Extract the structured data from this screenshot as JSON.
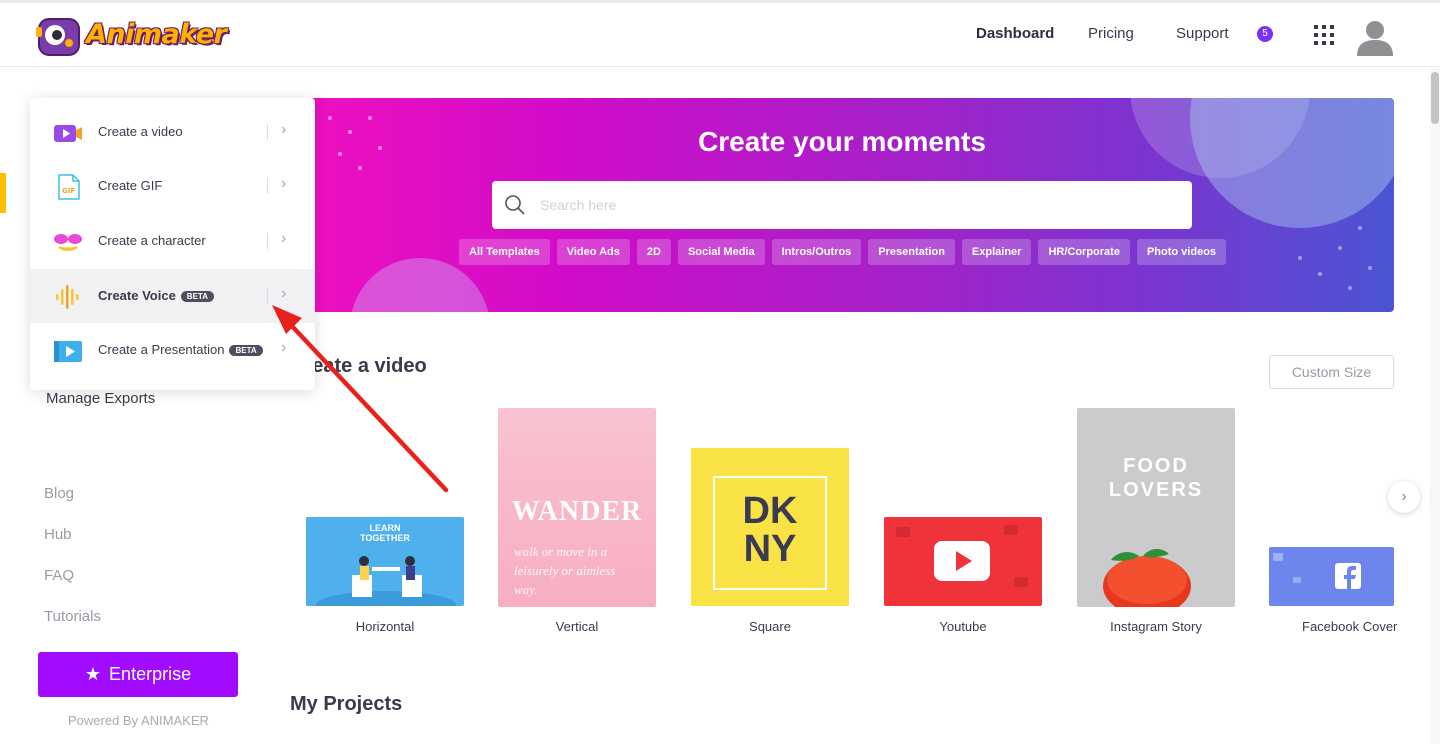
{
  "header": {
    "logo_text": "Animaker",
    "nav": [
      "Dashboard",
      "Pricing",
      "Support"
    ],
    "notification_count": "5"
  },
  "dropdown": {
    "items": [
      {
        "label": "Create a video",
        "beta": ""
      },
      {
        "label": "Create GIF",
        "beta": ""
      },
      {
        "label": "Create a character",
        "beta": ""
      },
      {
        "label": "Create Voice",
        "beta": "BETA"
      },
      {
        "label": "Create a Presentation",
        "beta": "BETA"
      }
    ]
  },
  "sidebar": {
    "manage_exports": "Manage Exports",
    "links": [
      "Blog",
      "Hub",
      "FAQ",
      "Tutorials"
    ],
    "enterprise_label": "Enterprise",
    "powered_by": "Powered By ANIMAKER"
  },
  "banner": {
    "title": "Create your moments",
    "search_placeholder": "Search here",
    "chips": [
      "All Templates",
      "Video Ads",
      "2D",
      "Social Media",
      "Intros/Outros",
      "Presentation",
      "Explainer",
      "HR/Corporate",
      "Photo videos"
    ]
  },
  "create_video": {
    "title": "Create a video",
    "custom_size": "Custom Size",
    "tiles": [
      {
        "label": "Horizontal",
        "art_text": "LEARN TOGETHER"
      },
      {
        "label": "Vertical",
        "art_text": "WANDER",
        "art_sub": "walk or move in a leisurely or aimless way."
      },
      {
        "label": "Square",
        "art_text": "DK NY"
      },
      {
        "label": "Youtube"
      },
      {
        "label": "Instagram Story",
        "art_text": "FOOD LOVERS"
      },
      {
        "label": "Facebook Cover"
      }
    ]
  },
  "my_projects": {
    "title": "My Projects"
  },
  "colors": {
    "accent": "#a10bff",
    "banner_start": "#ef10c0",
    "banner_end": "#4a55d2",
    "sidebar_accent": "#ffbf00",
    "arrow": "#e8211c"
  }
}
